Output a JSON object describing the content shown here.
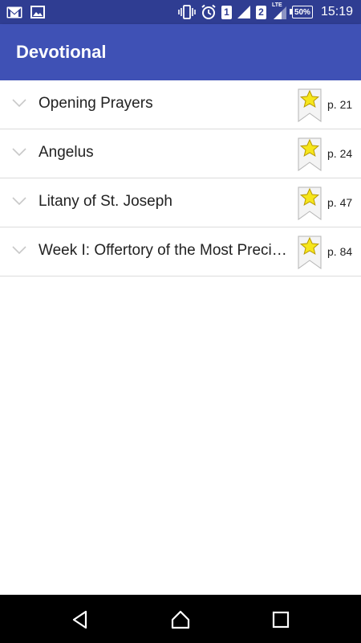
{
  "status_bar": {
    "icons_left": [
      "gmail-icon",
      "gallery-icon"
    ],
    "icons_right": [
      "vibrate-icon",
      "alarm-icon",
      "sim1-signal-icon",
      "sim2-lte-signal-icon"
    ],
    "sim1": "1",
    "sim2": "2",
    "network": "LTE",
    "battery": "50%",
    "time": "15:19"
  },
  "app_bar": {
    "title": "Devotional"
  },
  "list": {
    "items": [
      {
        "label": "Opening Prayers",
        "page": "p. 21"
      },
      {
        "label": "Angelus",
        "page": "p. 24"
      },
      {
        "label": "Litany of St. Joseph",
        "page": "p. 47"
      },
      {
        "label": "Week I: Offertory of the Most Precious Blood",
        "page": "p. 84"
      }
    ]
  },
  "colors": {
    "status_bar": "#2f3d92",
    "app_bar": "#3f51b5",
    "star": "#f6e61b",
    "divider": "#dcdcdc"
  },
  "nav_bar": {
    "icons": [
      "back-icon",
      "home-icon",
      "recents-icon"
    ]
  }
}
